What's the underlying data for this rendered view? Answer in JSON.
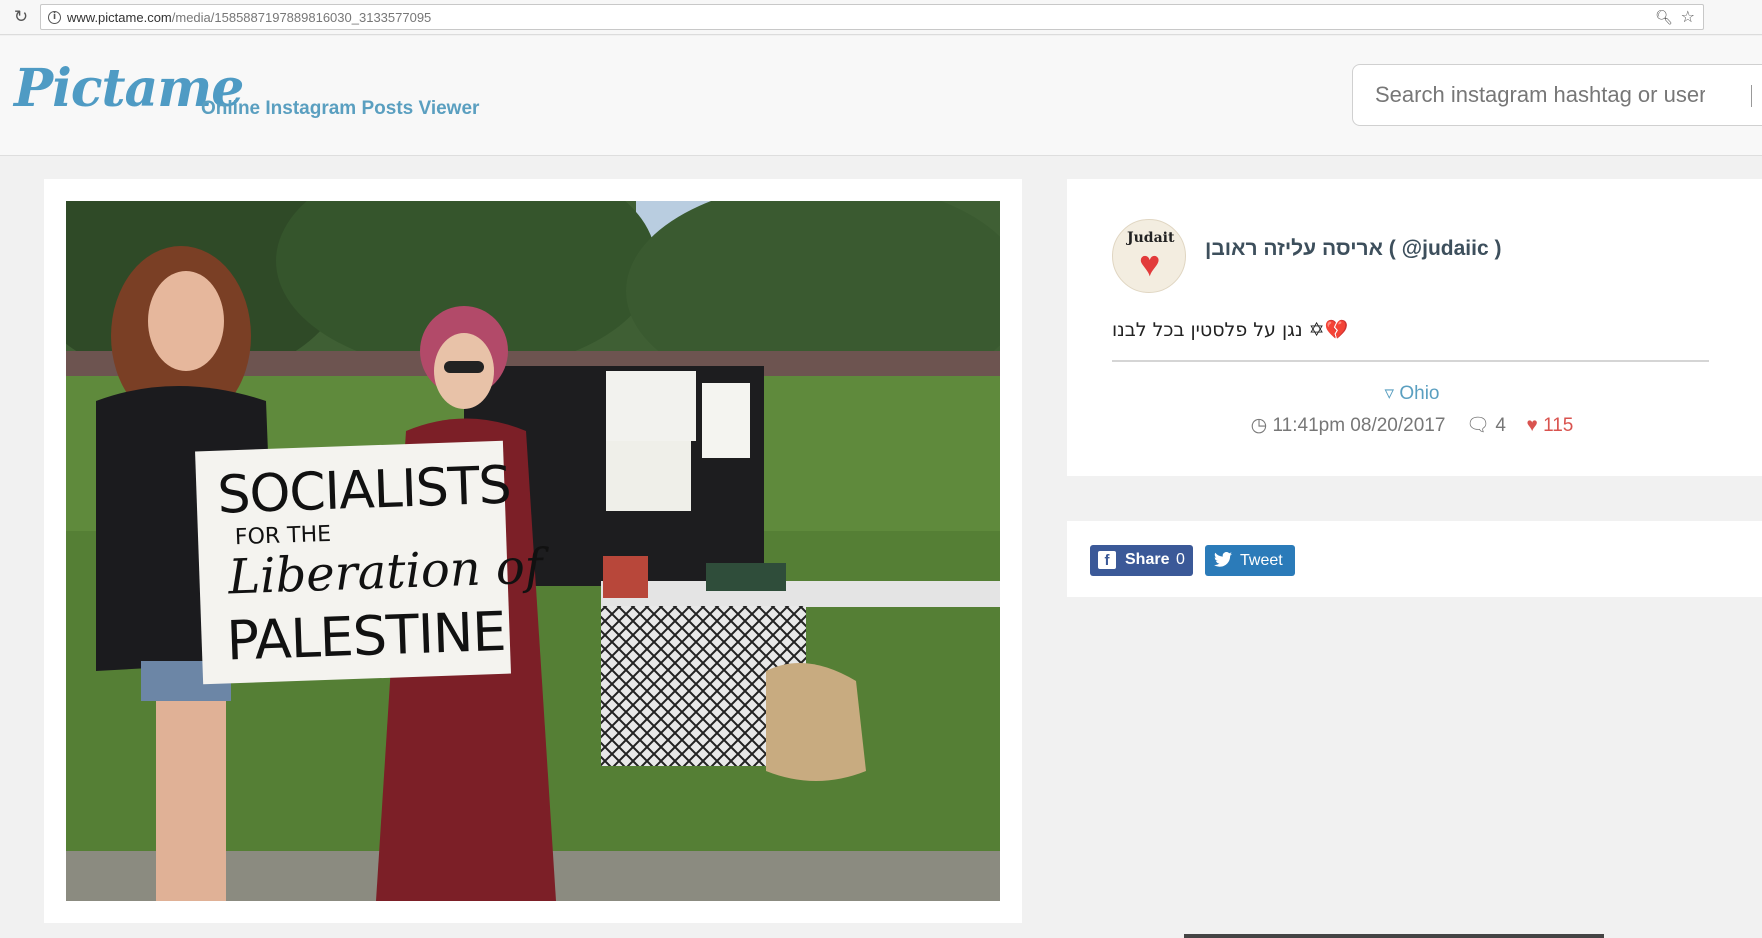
{
  "browser": {
    "url_host": "www.pictame.com",
    "url_path": "/media/1585887197889816030_3133577095"
  },
  "site": {
    "logo": "Pictame",
    "tagline": "Online Instagram Posts Viewer",
    "search_placeholder": "Search instagram hashtag or username"
  },
  "photo": {
    "sign_line1": "SOCIALISTS",
    "sign_line2": "FOR THE",
    "sign_line3": "Liberation of",
    "sign_line4": "PALESTINE"
  },
  "post": {
    "avatar_text": "Judait",
    "username": "אריסה עליזה ראובן ( @judaiic )",
    "caption": "נגן על פלסטין בכל לבנו ✡💔",
    "location": "Ohio",
    "timestamp": "11:41pm 08/20/2017",
    "comments": "4",
    "likes": "115"
  },
  "share": {
    "facebook_label": "Share",
    "facebook_count": "0",
    "twitter_label": "Tweet"
  },
  "colors": {
    "accent": "#5a9fc0",
    "likes": "#d9534f",
    "facebook": "#3b5998",
    "twitter": "#2b7bb9"
  }
}
